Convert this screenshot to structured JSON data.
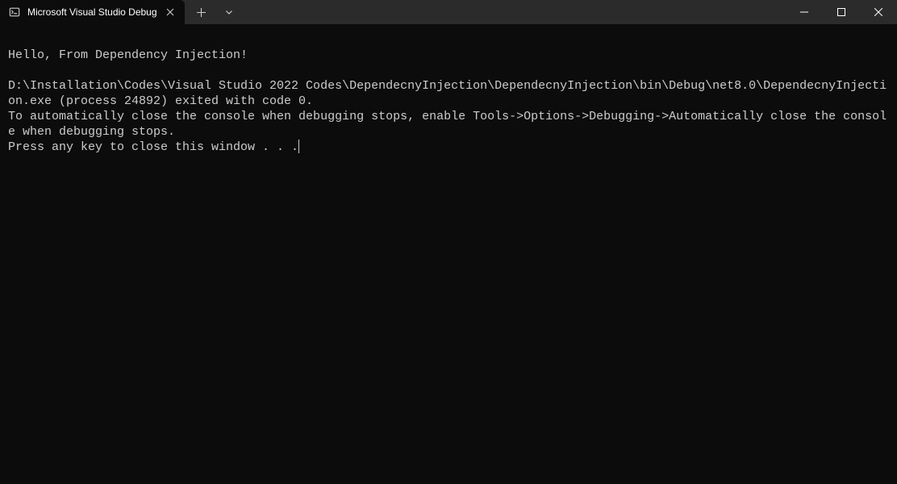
{
  "titlebar": {
    "tab": {
      "title": "Microsoft Visual Studio Debug"
    }
  },
  "console": {
    "line1": "Hello, From Dependency Injection!",
    "line2": "",
    "line3": "D:\\Installation\\Codes\\Visual Studio 2022 Codes\\DependecnyInjection\\DependecnyInjection\\bin\\Debug\\net8.0\\DependecnyInjection.exe (process 24892) exited with code 0.",
    "line4": "To automatically close the console when debugging stops, enable Tools->Options->Debugging->Automatically close the console when debugging stops.",
    "line5": "Press any key to close this window . . ."
  }
}
